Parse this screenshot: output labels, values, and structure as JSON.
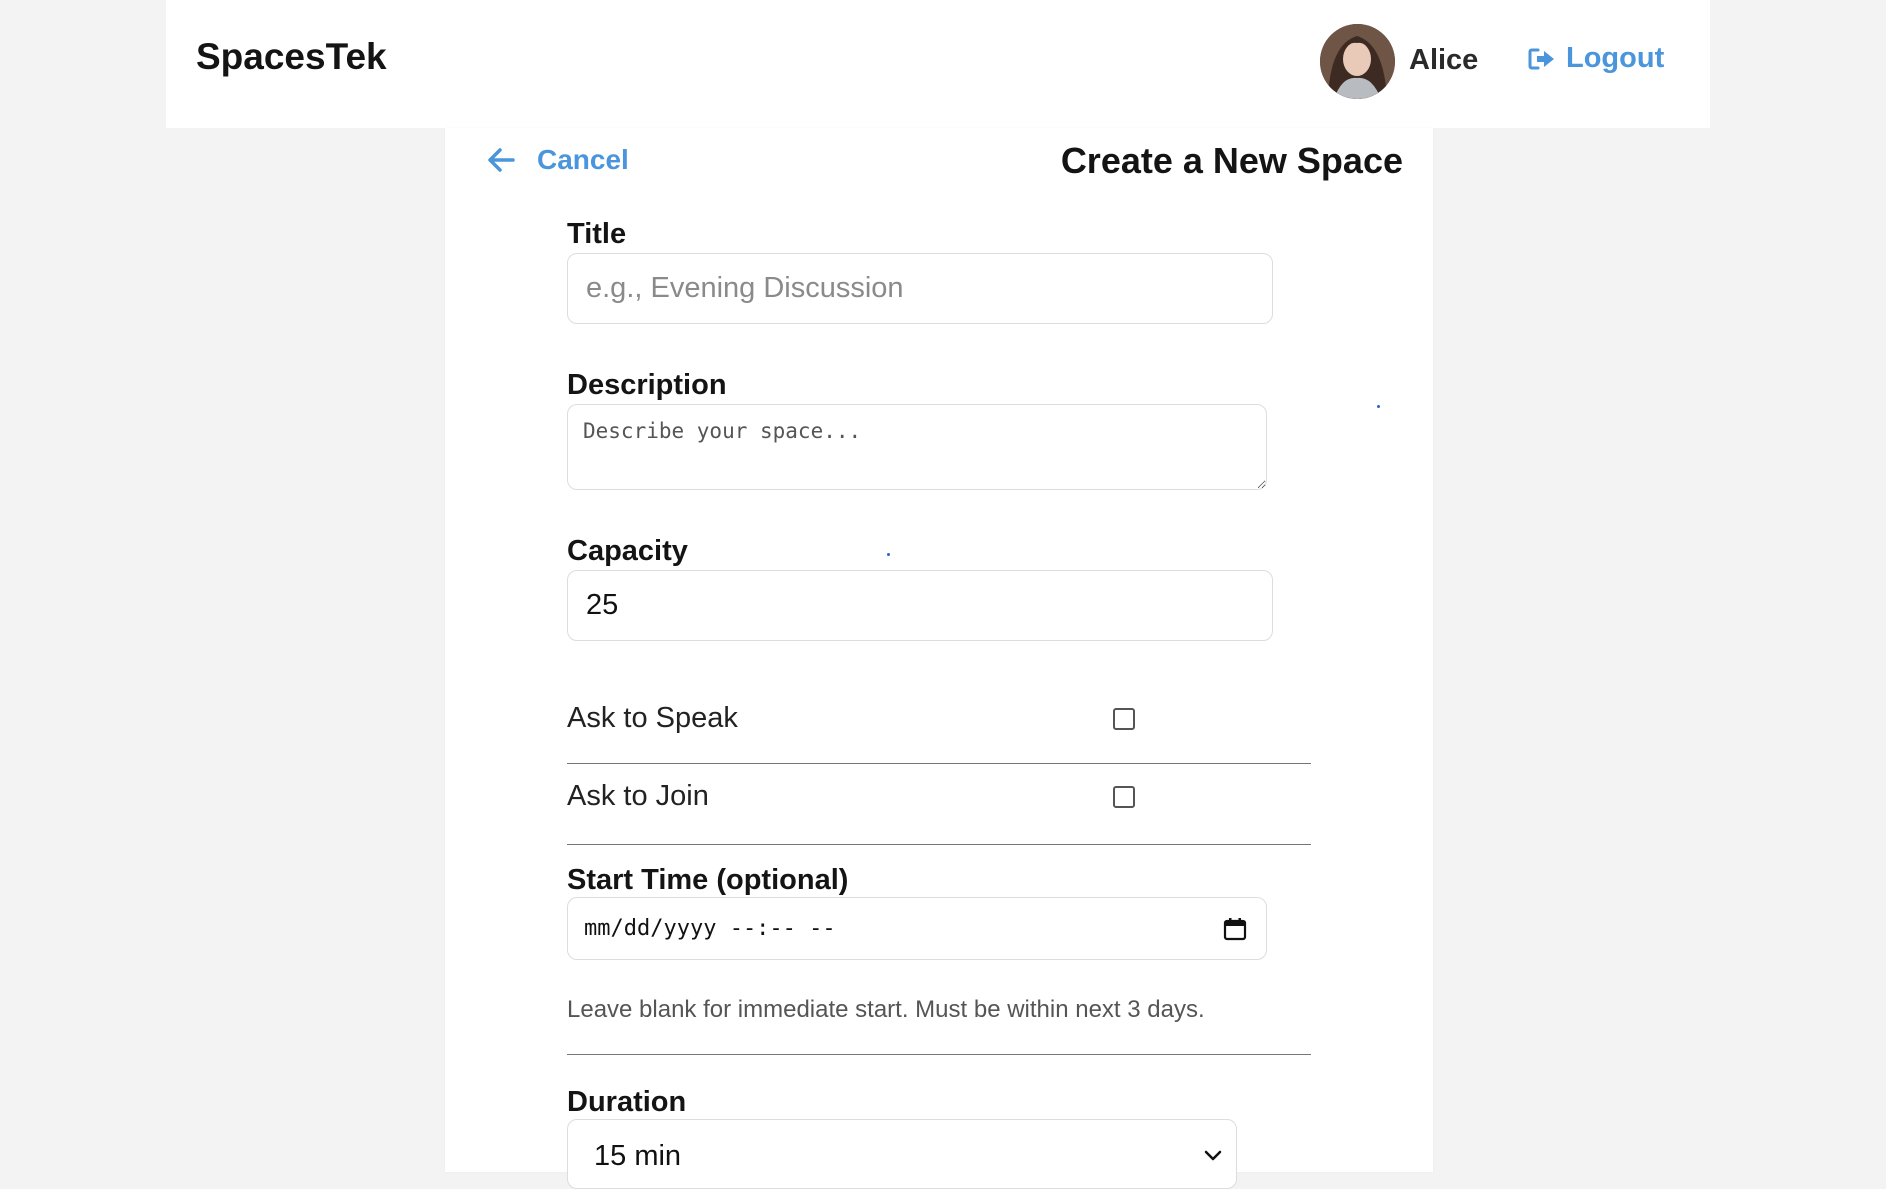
{
  "header": {
    "brand": "SpacesTek",
    "user_name": "Alice",
    "logout_label": "Logout"
  },
  "page": {
    "cancel_label": "Cancel",
    "title": "Create a New Space"
  },
  "form": {
    "title_label": "Title",
    "title_placeholder": "e.g., Evening Discussion",
    "title_value": "",
    "description_label": "Description",
    "description_placeholder": "Describe your space...",
    "description_value": "",
    "capacity_label": "Capacity",
    "capacity_value": "25",
    "ask_to_speak_label": "Ask to Speak",
    "ask_to_speak_checked": false,
    "ask_to_join_label": "Ask to Join",
    "ask_to_join_checked": false,
    "start_time_label": "Start Time (optional)",
    "start_time_placeholder": "mm/dd/yyyy --:-- --",
    "start_time_hint": "Leave blank for immediate start. Must be within next 3 days.",
    "duration_label": "Duration",
    "duration_value": "15 min"
  },
  "icons": {
    "logout": "sign-out-icon",
    "cancel": "arrow-left-icon",
    "calendar": "calendar-icon",
    "chevron": "chevron-down-icon"
  },
  "colors": {
    "accent": "#4a95db",
    "page_bg": "#f3f3f3",
    "card_bg": "#ffffff"
  }
}
